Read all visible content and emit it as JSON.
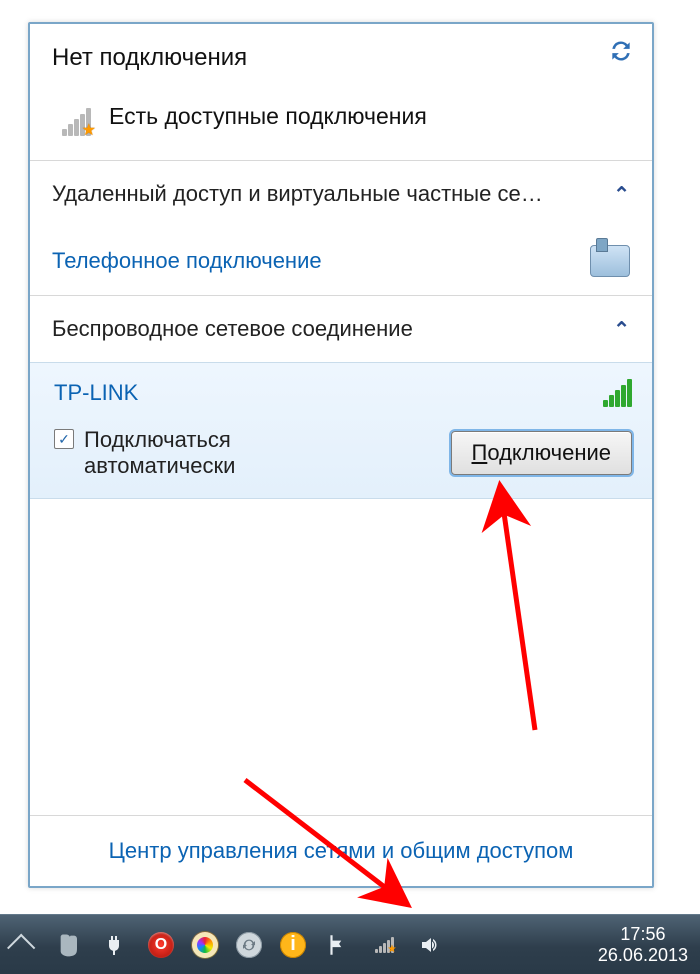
{
  "header": {
    "title": "Нет подключения"
  },
  "status": {
    "text": "Есть доступные подключения"
  },
  "sections": {
    "dialup": {
      "title": "Удаленный доступ и виртуальные частные се…",
      "item": "Телефонное подключение"
    },
    "wifi": {
      "title": "Беспроводное сетевое соединение"
    }
  },
  "network": {
    "name": "TP-LINK",
    "auto_label": "Подключаться автоматически",
    "auto_checked": true,
    "connect_prefix": "П",
    "connect_rest": "одключение"
  },
  "footer": {
    "link": "Центр управления сетями и общим доступом"
  },
  "taskbar": {
    "time": "17:56",
    "date": "26.06.2013"
  }
}
